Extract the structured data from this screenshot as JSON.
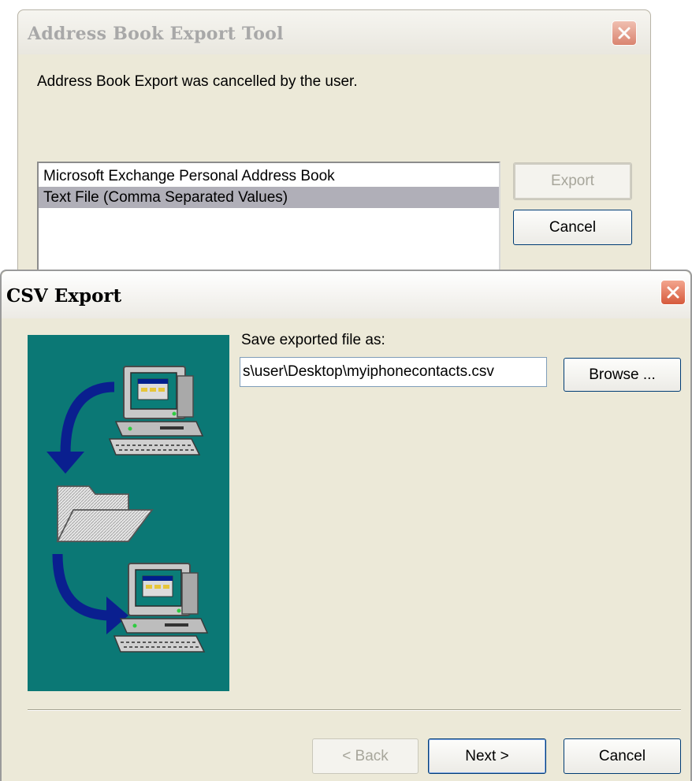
{
  "export_tool_dialog": {
    "title": "Address Book Export Tool",
    "message": "Address Book Export was cancelled by the user.",
    "list_items": [
      {
        "label": "Microsoft Exchange Personal Address Book",
        "selected": false
      },
      {
        "label": "Text File (Comma Separated Values)",
        "selected": true
      }
    ],
    "export_label": "Export",
    "export_enabled": false,
    "cancel_label": "Cancel",
    "close_icon": "close-icon"
  },
  "csv_dialog": {
    "title": "CSV Export",
    "save_label": "Save exported file as:",
    "file_path": "s\\user\\Desktop\\myiphonecontacts.csv",
    "browse_label": "Browse ...",
    "back_label": "< Back",
    "back_enabled": false,
    "next_label": "Next >",
    "cancel_label": "Cancel",
    "close_icon": "close-icon",
    "illustration": "export-wizard-illustration",
    "colors": {
      "illustration_bg": "#0b7875",
      "arrow": "#0a1f8f",
      "dialog_bg": "#ece9d8"
    }
  }
}
